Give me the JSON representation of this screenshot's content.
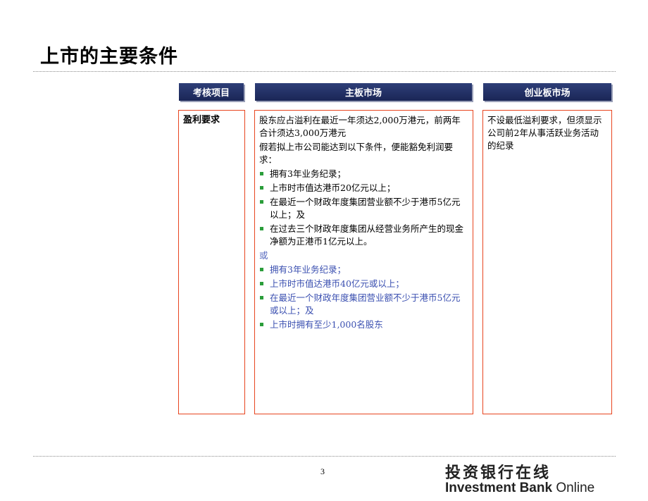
{
  "page": {
    "title": "上市的主要条件",
    "page_number": "3"
  },
  "headers": {
    "criteria": "考核项目",
    "main_board": "主板市场",
    "gem": "创业板市场"
  },
  "criteria_label": "盈利要求",
  "main_board": {
    "intro": "股东应占溢利在最近一年须达2,000万港元，前两年合计须达3,000万港元",
    "exemption": "假若拟上市公司能达到以下条件，便能豁免利润要求：",
    "option_a": [
      "拥有3年业务纪录；",
      "上市时市值达港币20亿元以上；",
      "在最近一个财政年度集团营业额不少于港币5亿元以上；及",
      "在过去三个财政年度集团从经营业务所产生的现金净额为正港币1亿元以上。"
    ],
    "or_label": "或",
    "option_b": [
      "拥有3年业务纪录；",
      "上市时市值达港币40亿元或以上；",
      "在最近一个财政年度集团营业额不少于港币5亿元或以上；及",
      "上市时拥有至少1,000名股东"
    ]
  },
  "gem": {
    "text": "不设最低溢利要求，但须显示公司前2年从事活跃业务活动的纪录"
  },
  "logo": {
    "cn": "投资银行在线",
    "en_bold": "Investment Bank",
    "en_light": "Online"
  },
  "colors": {
    "header_bg": "#1f2b60",
    "panel_border": "#e8451f",
    "bullet": "#2a9d3a",
    "option_b_text": "#3a4fb0"
  }
}
